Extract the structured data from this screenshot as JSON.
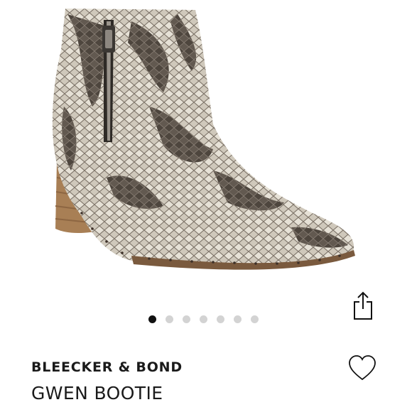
{
  "product": {
    "brand": "BLEECKER & BOND",
    "name": "GWEN BOOTIE",
    "image_description": "snakeskin ankle bootie",
    "colors": {
      "snake_light": "#e2ddd2",
      "snake_dark": "#5a5148",
      "heel": "#a87f55",
      "sole": "#7a5a3e"
    }
  },
  "carousel": {
    "dots": [
      {
        "active": true
      },
      {
        "active": false
      },
      {
        "active": false
      },
      {
        "active": false
      },
      {
        "active": false
      },
      {
        "active": false
      },
      {
        "active": false
      }
    ]
  },
  "actions": {
    "share_icon": "share-icon",
    "favorite_icon": "heart-icon"
  }
}
